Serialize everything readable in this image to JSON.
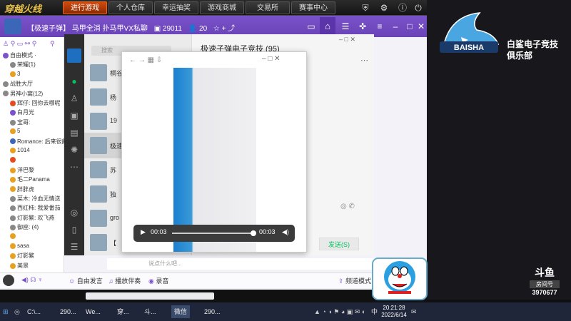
{
  "topbar": {
    "logo": "穿越火线",
    "tabs": [
      "进行游戏",
      "个人仓库",
      "幸运抽奖",
      "游戏商城",
      "交易所",
      "赛事中心"
    ],
    "active_tab": 0,
    "icons": [
      "shield-icon",
      "gear-icon",
      "info-icon",
      "power-icon"
    ]
  },
  "yy": {
    "room_title": "【极速子弹】 马甲全消 扑马甲VX私聊",
    "room_id": "29011",
    "online": "20",
    "channels": [
      {
        "label": "自由模式 ·",
        "color": "#7a52c9"
      },
      {
        "label": "荣耀(1)",
        "color": "#888"
      },
      {
        "label": "3",
        "color": "#e8a020"
      },
      {
        "label": "战胜大厅",
        "color": "#888"
      },
      {
        "label": "男神小窝(12)",
        "color": "#888"
      },
      {
        "label": "辉仔: 回你去哪呢",
        "color": "#e84a20"
      },
      {
        "label": "白月光",
        "color": "#7a52c9"
      },
      {
        "label": "宝哥:",
        "color": "#888"
      },
      {
        "label": "5",
        "color": "#e8a020"
      },
      {
        "label": "Romance: 后来很能",
        "color": "#3c66b8"
      },
      {
        "label": "1014",
        "color": "#e8a020"
      },
      {
        "label": "",
        "color": "#e84a20"
      },
      {
        "label": "洋巴黎",
        "color": "#e8a020"
      },
      {
        "label": "毛二Panama",
        "color": "#e8a020"
      },
      {
        "label": "胖胖虎",
        "color": "#e8a020"
      },
      {
        "label": "菜木: 冷血无情送",
        "color": "#888"
      },
      {
        "label": "西红柿: 我爱番茄",
        "color": "#888"
      },
      {
        "label": "灯影繁: 欢飞燕",
        "color": "#888"
      },
      {
        "label": "御座: (4)",
        "color": "#888"
      },
      {
        "label": "",
        "color": "#e8a020"
      },
      {
        "label": "sasa",
        "color": "#e8a020"
      },
      {
        "label": "灯影繁",
        "color": "#e8a020"
      },
      {
        "label": "美景",
        "color": "#e8a020"
      }
    ],
    "bottom": {
      "free_speech": "自由发言",
      "accompany": "播放伴奏",
      "record": "录音",
      "channel_mode": "频道模式"
    },
    "input_placeholder": "说点什么吧..."
  },
  "wechat": {
    "search_placeholder": "搜索",
    "chat_title": "极速子弹电子竞技 (95)",
    "rows": [
      "桐谷",
      "杨",
      "19",
      "极速",
      "苏",
      "独",
      "gro",
      "【"
    ],
    "send_label": "发送(S)"
  },
  "video": {
    "current": "00:03",
    "duration": "00:03",
    "progress": 1.0
  },
  "stream": {
    "club_name_line1": "白鲨电子竞技",
    "club_name_line2": "俱乐部",
    "logo_text": "BAISHA",
    "douyu_label": "斗鱼",
    "room_label": "房间号",
    "room_number": "3970677"
  },
  "taskbar": {
    "items": [
      "C:\\...",
      "290...",
      "We...",
      "穿...",
      "斗...",
      "微信",
      "290..."
    ],
    "time": "20:21:28",
    "date": "2022/6/14",
    "lang": "中"
  }
}
